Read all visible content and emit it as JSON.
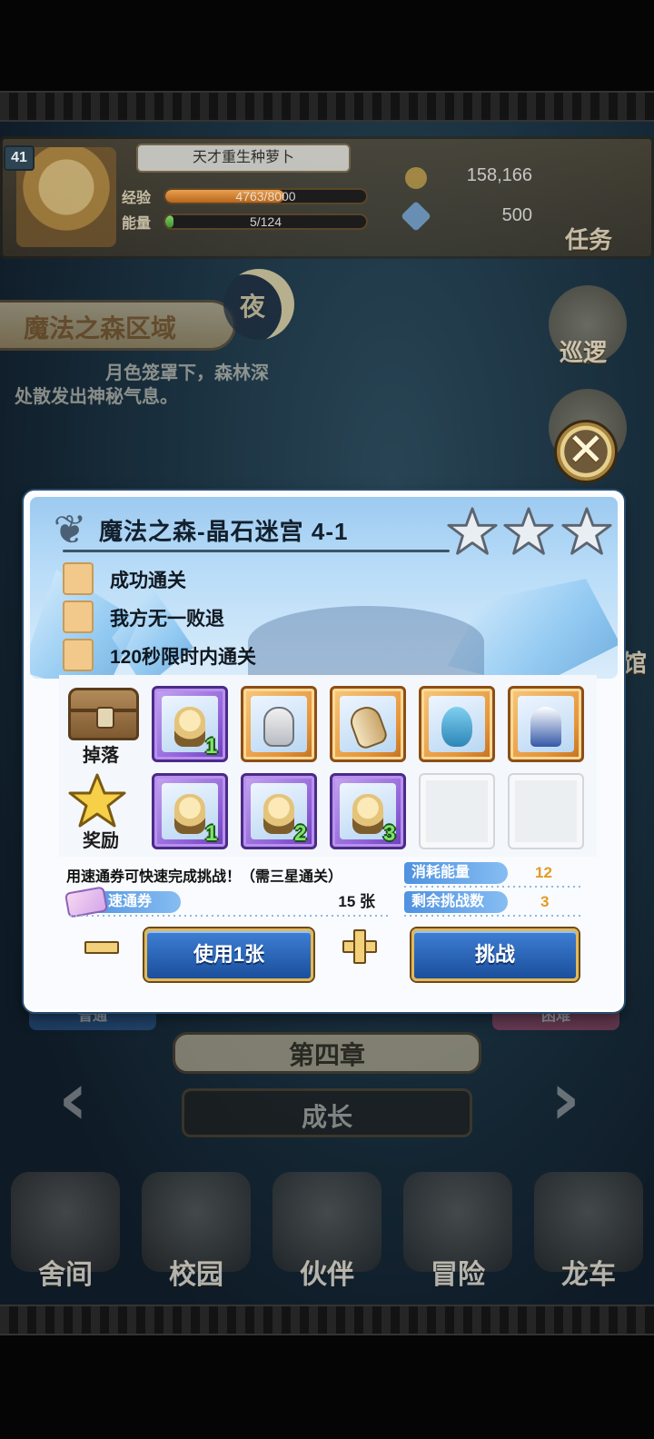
{
  "header": {
    "level": "41",
    "player_name": "天才重生种萝卜",
    "exp_label": "经验",
    "exp_value": "4763/8000",
    "exp_ratio": 0.595,
    "energy_label": "能量",
    "energy_value": "5/124",
    "energy_ratio": 0.04,
    "gold": "158,166",
    "gems": "500",
    "task_label": "任务"
  },
  "region": {
    "name": "魔法之森区域",
    "time_badge": "夜",
    "description_line1": "月色笼罩下，森林深",
    "description_line2": "处散发出神秘气息。"
  },
  "side_buttons": {
    "patrol": "巡逻",
    "partial_label": "馆"
  },
  "dialog": {
    "title": "魔法之森-晶石迷宫 4-1",
    "stars_earned": 0,
    "stars_total": 3,
    "objectives": [
      "成功通关",
      "我方无一败退",
      "120秒限时内通关"
    ],
    "drops_label": "掉落",
    "rewards_label": "奖励",
    "drops": [
      {
        "icon": "character-shard-icon",
        "rarity": "purple",
        "count": "1"
      },
      {
        "icon": "armor-icon",
        "rarity": "orange",
        "count": ""
      },
      {
        "icon": "scroll-icon",
        "rarity": "orange",
        "count": ""
      },
      {
        "icon": "hat-icon",
        "rarity": "orange",
        "count": ""
      },
      {
        "icon": "cloak-icon",
        "rarity": "orange",
        "count": ""
      }
    ],
    "rewards": [
      {
        "icon": "character-shard-icon",
        "rarity": "purple",
        "count": "1"
      },
      {
        "icon": "character-shard-icon",
        "rarity": "purple",
        "count": "2"
      },
      {
        "icon": "character-shard-icon",
        "rarity": "purple",
        "count": "3"
      },
      {
        "icon": "empty-slot",
        "rarity": "empty",
        "count": ""
      },
      {
        "icon": "empty-slot",
        "rarity": "empty",
        "count": ""
      }
    ],
    "quick_note": "用速通券可快速完成挑战！（需三星通关）",
    "ticket_label": "速通券",
    "ticket_count": "15 张",
    "energy_cost_label": "消耗能量",
    "energy_cost_value": "12",
    "remaining_label": "剩余挑战数",
    "remaining_value": "3",
    "use_button": "使用1张",
    "challenge_button": "挑战",
    "colors": {
      "accent_blue": "#2f6fc4",
      "value_orange": "#e39b24",
      "gold_border": "#e2b85a"
    }
  },
  "chapter": {
    "title": "第四章",
    "subtitle": "成长",
    "difficulty_normal": "普通",
    "difficulty_hard": "困难"
  },
  "bottom_nav": [
    {
      "label": "舍间",
      "icon": "house-icon"
    },
    {
      "label": "校园",
      "icon": "school-icon"
    },
    {
      "label": "伙伴",
      "icon": "partner-icon"
    },
    {
      "label": "冒险",
      "icon": "adventure-icon"
    },
    {
      "label": "龙车",
      "icon": "dragon-cart-icon"
    }
  ]
}
